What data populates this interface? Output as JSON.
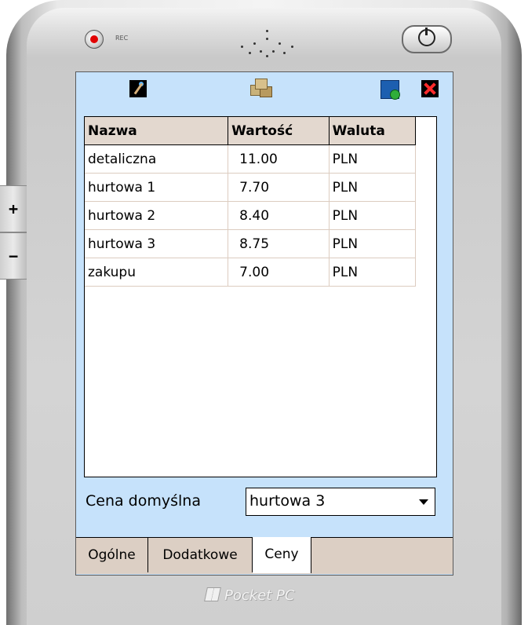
{
  "device": {
    "rec_label": "REC",
    "side_plus": "+",
    "side_minus": "−",
    "brand": "Pocket PC"
  },
  "toolbar": {
    "icons": [
      "magic-wand-icon",
      "boxes-icon",
      "save-confirm-icon",
      "close-icon"
    ]
  },
  "grid": {
    "columns": [
      "Nazwa",
      "Wartość",
      "Waluta"
    ],
    "rows": [
      [
        "detaliczna",
        "11.00",
        "PLN"
      ],
      [
        "hurtowa 1",
        "7.70",
        "PLN"
      ],
      [
        "hurtowa 2",
        "8.40",
        "PLN"
      ],
      [
        "hurtowa 3",
        "8.75",
        "PLN"
      ],
      [
        "zakupu",
        "7.00",
        "PLN"
      ]
    ]
  },
  "default_price": {
    "label": "Cena domyślna",
    "selected": "hurtowa 3"
  },
  "tabs": [
    {
      "label": "Ogólne",
      "active": false
    },
    {
      "label": "Dodatkowe",
      "active": false
    },
    {
      "label": "Ceny",
      "active": true
    }
  ],
  "colors": {
    "screen_bg": "#c6e2fb",
    "header_bg": "#e3d8cf",
    "tabbar_bg": "#dccfc4"
  }
}
